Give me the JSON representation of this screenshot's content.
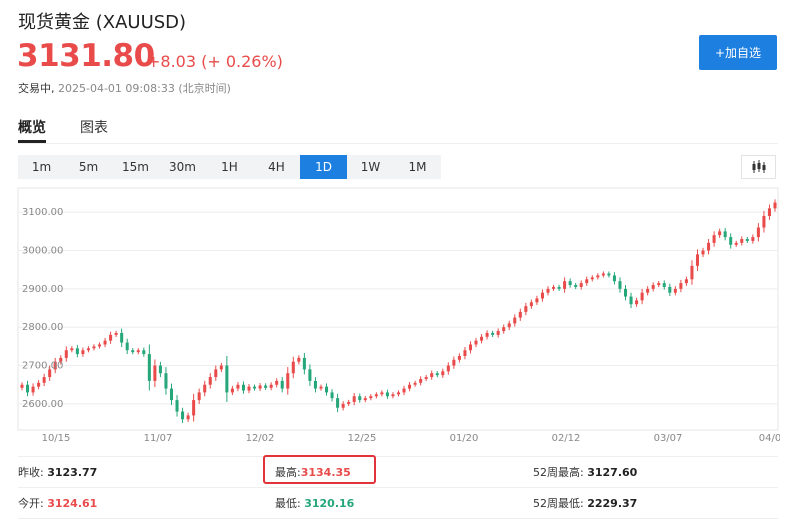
{
  "header": {
    "title": "现货黄金  (XAUUSD)",
    "price": "3131.80",
    "change": "+8.03 (+ 0.26%)",
    "status": "交易中,",
    "datetime": "2025-04-01 09:08:33 (北京时间)",
    "add_button": "+加自选"
  },
  "tabs": [
    {
      "label": "概览",
      "active": true
    },
    {
      "label": "图表",
      "active": false
    }
  ],
  "periods": [
    "1m",
    "5m",
    "15m",
    "30m",
    "1H",
    "4H",
    "1D",
    "1W",
    "1M"
  ],
  "active_period": "1D",
  "colors": {
    "up": "#e94b4b",
    "down": "#26a77a",
    "accent": "#1d7fe0"
  },
  "chart_data": {
    "type": "candlestick",
    "y_ticks": [
      "3100.00",
      "3000.00",
      "2900.00",
      "2800.00",
      "2700.00",
      "2600.00"
    ],
    "x_ticks": [
      "10/15",
      "11/07",
      "12/02",
      "12/25",
      "01/20",
      "02/12",
      "03/07",
      "04/0"
    ],
    "ylim": [
      2545,
      3150
    ],
    "closes": [
      2650,
      2630,
      2645,
      2655,
      2670,
      2690,
      2710,
      2720,
      2740,
      2745,
      2730,
      2740,
      2745,
      2750,
      2755,
      2765,
      2780,
      2785,
      2760,
      2740,
      2735,
      2740,
      2730,
      2660,
      2700,
      2680,
      2640,
      2610,
      2580,
      2560,
      2570,
      2610,
      2630,
      2650,
      2670,
      2690,
      2700,
      2630,
      2640,
      2650,
      2635,
      2645,
      2640,
      2648,
      2642,
      2650,
      2660,
      2640,
      2680,
      2710,
      2720,
      2690,
      2660,
      2640,
      2645,
      2630,
      2615,
      2590,
      2600,
      2605,
      2620,
      2610,
      2615,
      2620,
      2625,
      2630,
      2620,
      2625,
      2630,
      2640,
      2650,
      2655,
      2665,
      2670,
      2680,
      2675,
      2685,
      2700,
      2715,
      2725,
      2740,
      2755,
      2765,
      2775,
      2785,
      2780,
      2790,
      2800,
      2810,
      2825,
      2840,
      2855,
      2865,
      2875,
      2890,
      2900,
      2905,
      2900,
      2920,
      2910,
      2905,
      2915,
      2925,
      2930,
      2935,
      2940,
      2935,
      2920,
      2900,
      2880,
      2860,
      2870,
      2890,
      2900,
      2910,
      2915,
      2905,
      2890,
      2900,
      2915,
      2925,
      2960,
      2990,
      3000,
      3020,
      3040,
      3050,
      3035,
      3015,
      3020,
      3030,
      3025,
      3035,
      3060,
      3090,
      3110,
      3125
    ]
  },
  "stats": {
    "prev_close": {
      "label": "昨收:",
      "value": "3123.77"
    },
    "high": {
      "label": "最高:",
      "value": "3134.35"
    },
    "high52": {
      "label": "52周最高:",
      "value": "3127.60"
    },
    "open": {
      "label": "今开:",
      "value": "3124.61"
    },
    "low": {
      "label": "最低:",
      "value": "3120.16"
    },
    "low52": {
      "label": "52周最低:",
      "value": "2229.37"
    }
  }
}
